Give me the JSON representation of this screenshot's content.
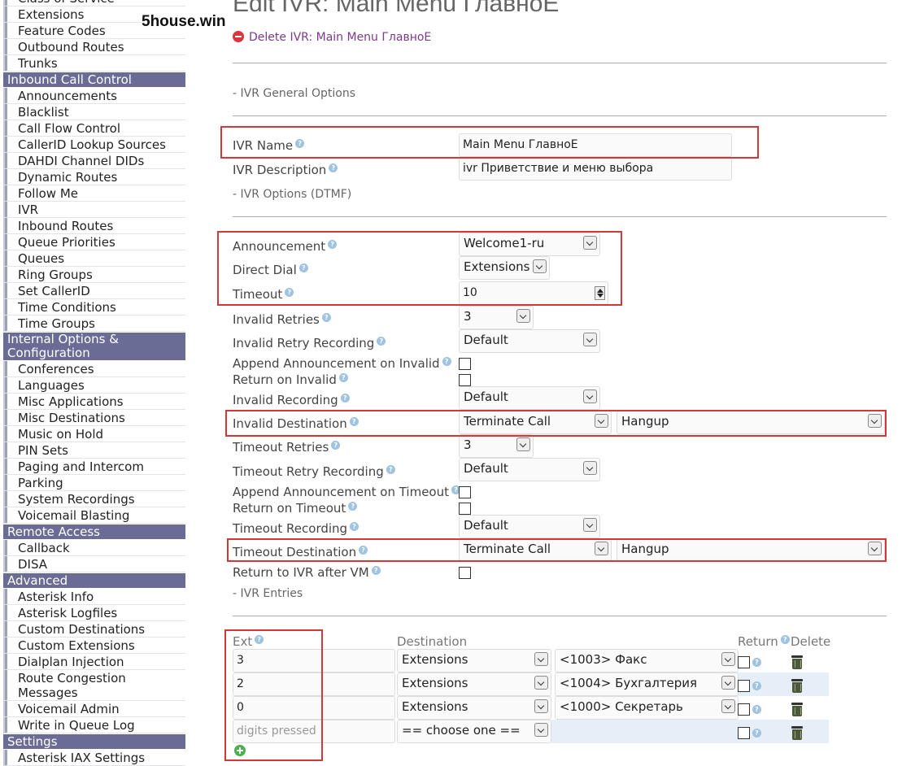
{
  "sidebar": {
    "items": [
      {
        "type": "item",
        "label": "Class of Service"
      },
      {
        "type": "item",
        "label": "Extensions"
      },
      {
        "type": "item",
        "label": "Feature Codes"
      },
      {
        "type": "item",
        "label": "Outbound Routes"
      },
      {
        "type": "item",
        "label": "Trunks"
      },
      {
        "type": "header",
        "label": "Inbound Call Control"
      },
      {
        "type": "item",
        "label": "Announcements"
      },
      {
        "type": "item",
        "label": "Blacklist"
      },
      {
        "type": "item",
        "label": "Call Flow Control"
      },
      {
        "type": "item",
        "label": "CallerID Lookup Sources"
      },
      {
        "type": "item",
        "label": "DAHDI Channel DIDs"
      },
      {
        "type": "item",
        "label": "Dynamic Routes"
      },
      {
        "type": "item",
        "label": "Follow Me"
      },
      {
        "type": "item",
        "label": "IVR"
      },
      {
        "type": "item",
        "label": "Inbound Routes"
      },
      {
        "type": "item",
        "label": "Queue Priorities"
      },
      {
        "type": "item",
        "label": "Queues"
      },
      {
        "type": "item",
        "label": "Ring Groups"
      },
      {
        "type": "item",
        "label": "Set CallerID"
      },
      {
        "type": "item",
        "label": "Time Conditions"
      },
      {
        "type": "item",
        "label": "Time Groups"
      },
      {
        "type": "header",
        "label": "Internal Options & Configuration",
        "two": true
      },
      {
        "type": "item",
        "label": "Conferences"
      },
      {
        "type": "item",
        "label": "Languages"
      },
      {
        "type": "item",
        "label": "Misc Applications"
      },
      {
        "type": "item",
        "label": "Misc Destinations"
      },
      {
        "type": "item",
        "label": "Music on Hold"
      },
      {
        "type": "item",
        "label": "PIN Sets"
      },
      {
        "type": "item",
        "label": "Paging and Intercom"
      },
      {
        "type": "item",
        "label": "Parking"
      },
      {
        "type": "item",
        "label": "System Recordings"
      },
      {
        "type": "item",
        "label": "Voicemail Blasting"
      },
      {
        "type": "header",
        "label": "Remote Access"
      },
      {
        "type": "item",
        "label": "Callback"
      },
      {
        "type": "item",
        "label": "DISA"
      },
      {
        "type": "header",
        "label": "Advanced"
      },
      {
        "type": "item",
        "label": "Asterisk Info"
      },
      {
        "type": "item",
        "label": "Asterisk Logfiles"
      },
      {
        "type": "item",
        "label": "Custom Destinations"
      },
      {
        "type": "item",
        "label": "Custom Extensions"
      },
      {
        "type": "item",
        "label": "Dialplan Injection"
      },
      {
        "type": "item",
        "label": "Route Congestion Messages",
        "two": true
      },
      {
        "type": "item",
        "label": "Voicemail Admin"
      },
      {
        "type": "item",
        "label": "Write in Queue Log"
      },
      {
        "type": "header",
        "label": "Settings"
      },
      {
        "type": "item",
        "label": "Asterisk IAX Settings"
      }
    ]
  },
  "watermark": "5house.win",
  "page": {
    "title": "Edit IVR: Main Menu ГлавноЕ",
    "delete_label": "Delete IVR: Main Menu ГлавноЕ",
    "section_general": "- IVR General Options",
    "section_dtmf": "- IVR Options (DTMF)",
    "section_entries": "- IVR Entries"
  },
  "form": {
    "ivr_name": {
      "label": "IVR Name",
      "value": "Main Menu ГлавноЕ"
    },
    "ivr_description": {
      "label": "IVR Description",
      "value": "ivr Приветствие и меню выбора"
    },
    "announcement": {
      "label": "Announcement",
      "value": "Welcome1-ru"
    },
    "direct_dial": {
      "label": "Direct Dial",
      "value": "Extensions"
    },
    "timeout": {
      "label": "Timeout",
      "value": "10"
    },
    "invalid_retries": {
      "label": "Invalid Retries",
      "value": "3"
    },
    "invalid_retry_recording": {
      "label": "Invalid Retry Recording",
      "value": "Default"
    },
    "append_announcement_invalid": {
      "label": "Append Announcement on Invalid"
    },
    "return_on_invalid": {
      "label": "Return on Invalid"
    },
    "invalid_recording": {
      "label": "Invalid Recording",
      "value": "Default"
    },
    "invalid_destination": {
      "label": "Invalid Destination",
      "value": "Terminate Call",
      "sub_value": "Hangup"
    },
    "timeout_retries": {
      "label": "Timeout Retries",
      "value": "3"
    },
    "timeout_retry_recording": {
      "label": "Timeout Retry Recording",
      "value": "Default"
    },
    "append_announcement_timeout": {
      "label": "Append Announcement on Timeout"
    },
    "return_on_timeout": {
      "label": "Return on Timeout"
    },
    "timeout_recording": {
      "label": "Timeout Recording",
      "value": "Default"
    },
    "timeout_destination": {
      "label": "Timeout Destination",
      "value": "Terminate Call",
      "sub_value": "Hangup"
    },
    "return_to_ivr_after_vm": {
      "label": "Return to IVR after VM"
    }
  },
  "entries": {
    "headers": {
      "ext": "Ext",
      "destination": "Destination",
      "return": "Return",
      "delete": "Delete"
    },
    "rows": [
      {
        "ext": "3",
        "destination": "Extensions",
        "target": "<1003> Факс"
      },
      {
        "ext": "2",
        "destination": "Extensions",
        "target": "<1004> Бухгалтерия"
      },
      {
        "ext": "0",
        "destination": "Extensions",
        "target": "<1000> Секретарь"
      }
    ],
    "new_row": {
      "ext_placeholder": "digits pressed",
      "destination": "== choose one =="
    }
  },
  "colors": {
    "sidebar_header": "#6a6c96",
    "highlight_box": "#d33838",
    "link": "#7b3a8a"
  }
}
